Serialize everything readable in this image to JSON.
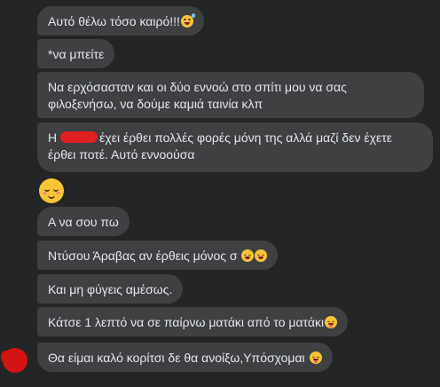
{
  "messages": [
    {
      "text": "Αυτό θέλω τόσο καιρό!!!",
      "emoji": "sweat-smile-emoji"
    },
    {
      "text": "*να μπείτε"
    },
    {
      "text": "Να ερχόσασταν και οι δύο εννοώ στο σπίτι μου να σας φιλοξενήσω, να δούμε καμιά ταινία κλπ"
    },
    {
      "text_before": "Η",
      "text_after": "έχει έρθει πολλές φορές μόνη της αλλά μαζί δεν έχετε έρθει ποτέ. Αυτό εννοούσα",
      "redacted": true
    },
    {
      "emoji_only": "relieved-face-emoji"
    },
    {
      "text": "Α να σου πω"
    },
    {
      "text": "Ντύσου Άραβας αν έρθεις μόνος σ",
      "emoji": "laughing-emoji",
      "emoji_count": 2
    },
    {
      "text": "Και μη φύγεις αμέσως."
    },
    {
      "text": "Κάτσε 1 λεπτό να σε παίρνω ματάκι από το ματάκι",
      "emoji": "zany-face-emoji"
    },
    {
      "text": "Θα είμαι καλό κορίτσι δε θα ανοίξω,Υπόσχομαι",
      "emoji": "zany-face-emoji"
    }
  ],
  "theme": {
    "background": "#242526",
    "bubble": "#3e4042",
    "text": "#e4e6eb",
    "redaction": "#e02020"
  }
}
